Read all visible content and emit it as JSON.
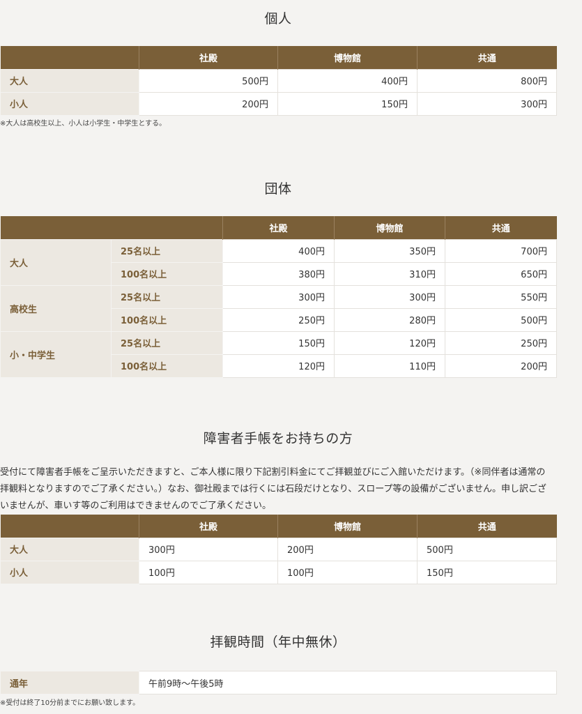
{
  "individual": {
    "title": "個人",
    "headers": [
      "",
      "社殿",
      "博物館",
      "共通"
    ],
    "rows": [
      {
        "label": "大人",
        "values": [
          "500円",
          "400円",
          "800円"
        ]
      },
      {
        "label": "小人",
        "values": [
          "200円",
          "150円",
          "300円"
        ]
      }
    ],
    "note": "※大人は高校生以上、小人は小学生・中学生とする。"
  },
  "group": {
    "title": "団体",
    "headers": [
      "",
      "社殿",
      "博物館",
      "共通"
    ],
    "categories": [
      {
        "label": "大人",
        "rows": [
          {
            "size": "25名以上",
            "values": [
              "400円",
              "350円",
              "700円"
            ]
          },
          {
            "size": "100名以上",
            "values": [
              "380円",
              "310円",
              "650円"
            ]
          }
        ]
      },
      {
        "label": "高校生",
        "rows": [
          {
            "size": "25名以上",
            "values": [
              "300円",
              "300円",
              "550円"
            ]
          },
          {
            "size": "100名以上",
            "values": [
              "250円",
              "280円",
              "500円"
            ]
          }
        ]
      },
      {
        "label": "小・中学生",
        "rows": [
          {
            "size": "25名以上",
            "values": [
              "150円",
              "120円",
              "250円"
            ]
          },
          {
            "size": "100名以上",
            "values": [
              "120円",
              "110円",
              "200円"
            ]
          }
        ]
      }
    ]
  },
  "disability": {
    "title": "障害者手帳をお持ちの方",
    "description_lines": [
      "受付にて障害者手帳をご呈示いただきますと、ご本人様に限り下記割引料金にてご拝観並びにご入館いただけます。（※同伴者は通常の",
      "拝観料となりますのでご了承ください。）なお、御社殿までは行くには石段だけとなり、スロープ等の設備がございません。申し訳ござ",
      "いませんが、車いす等のご利用はできませんのでご了承ください。"
    ],
    "headers": [
      "",
      "社殿",
      "博物館",
      "共通"
    ],
    "rows": [
      {
        "label": "大人",
        "values": [
          "300円",
          "200円",
          "500円"
        ]
      },
      {
        "label": "小人",
        "values": [
          "100円",
          "100円",
          "150円"
        ]
      }
    ]
  },
  "hours": {
    "title": "拝観時間（年中無休）",
    "label": "通年",
    "value": "午前9時〜午後5時",
    "note": "※受付は終了10分前までにお願い致します。"
  }
}
